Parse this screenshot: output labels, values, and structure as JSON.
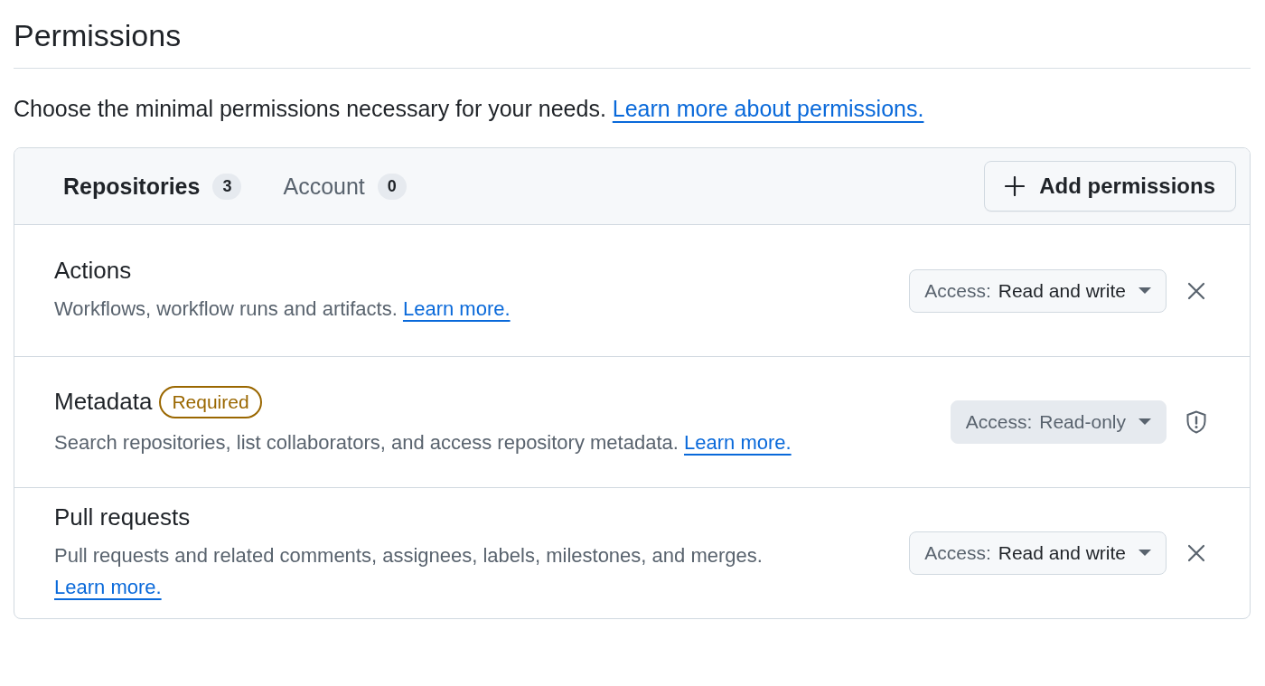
{
  "title": "Permissions",
  "intro": {
    "text": "Choose the minimal permissions necessary for your needs.",
    "link": "Learn more about permissions."
  },
  "tabs": [
    {
      "label": "Repositories",
      "count": "3",
      "selected": true
    },
    {
      "label": "Account",
      "count": "0",
      "selected": false
    }
  ],
  "add_button": {
    "label": "Add permissions"
  },
  "permissions": [
    {
      "name": "Actions",
      "description": "Workflows, workflow runs and artifacts.",
      "link": "Learn more.",
      "access_label": "Access:",
      "access_value": "Read and write",
      "required": false
    },
    {
      "name": "Metadata",
      "badge": "Required",
      "description": "Search repositories, list collaborators, and access repository metadata.",
      "link": "Learn more.",
      "access_label": "Access:",
      "access_value": "Read-only",
      "required": true
    },
    {
      "name": "Pull requests",
      "description": "Pull requests and related comments, assignees, labels, milestones, and merges.",
      "link": "Learn more.",
      "access_label": "Access:",
      "access_value": "Read and write",
      "required": false
    }
  ]
}
